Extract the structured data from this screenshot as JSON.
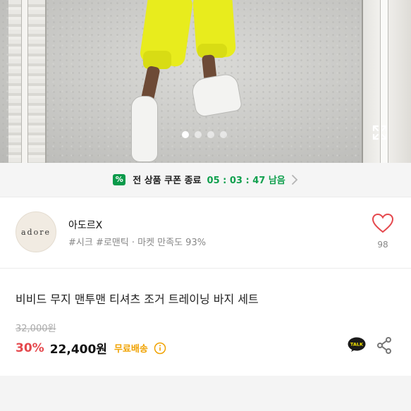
{
  "hero": {
    "slide_count": 4,
    "active_slide": 0
  },
  "coupon": {
    "badge": "%",
    "message": "전 상품 쿠폰 종료",
    "countdown": "05 : 03 : 47 남음"
  },
  "shop": {
    "logo_text": "adore",
    "name": "아도르X",
    "tags": "#시크 #로맨틱 · 마켓 만족도 93%",
    "likes": "98"
  },
  "product": {
    "title": "비비드 무지 맨투맨 티셔츠 조거 트레이닝 바지 세트",
    "original_price": "32,000원",
    "discount": "30%",
    "price": "22,400원",
    "shipping": "무료배송",
    "talk_label": "TALK"
  },
  "colors": {
    "discount": "#e5484d",
    "shipping": "#f0a200",
    "countdown": "#11a04e",
    "heart": "#e5484d"
  }
}
